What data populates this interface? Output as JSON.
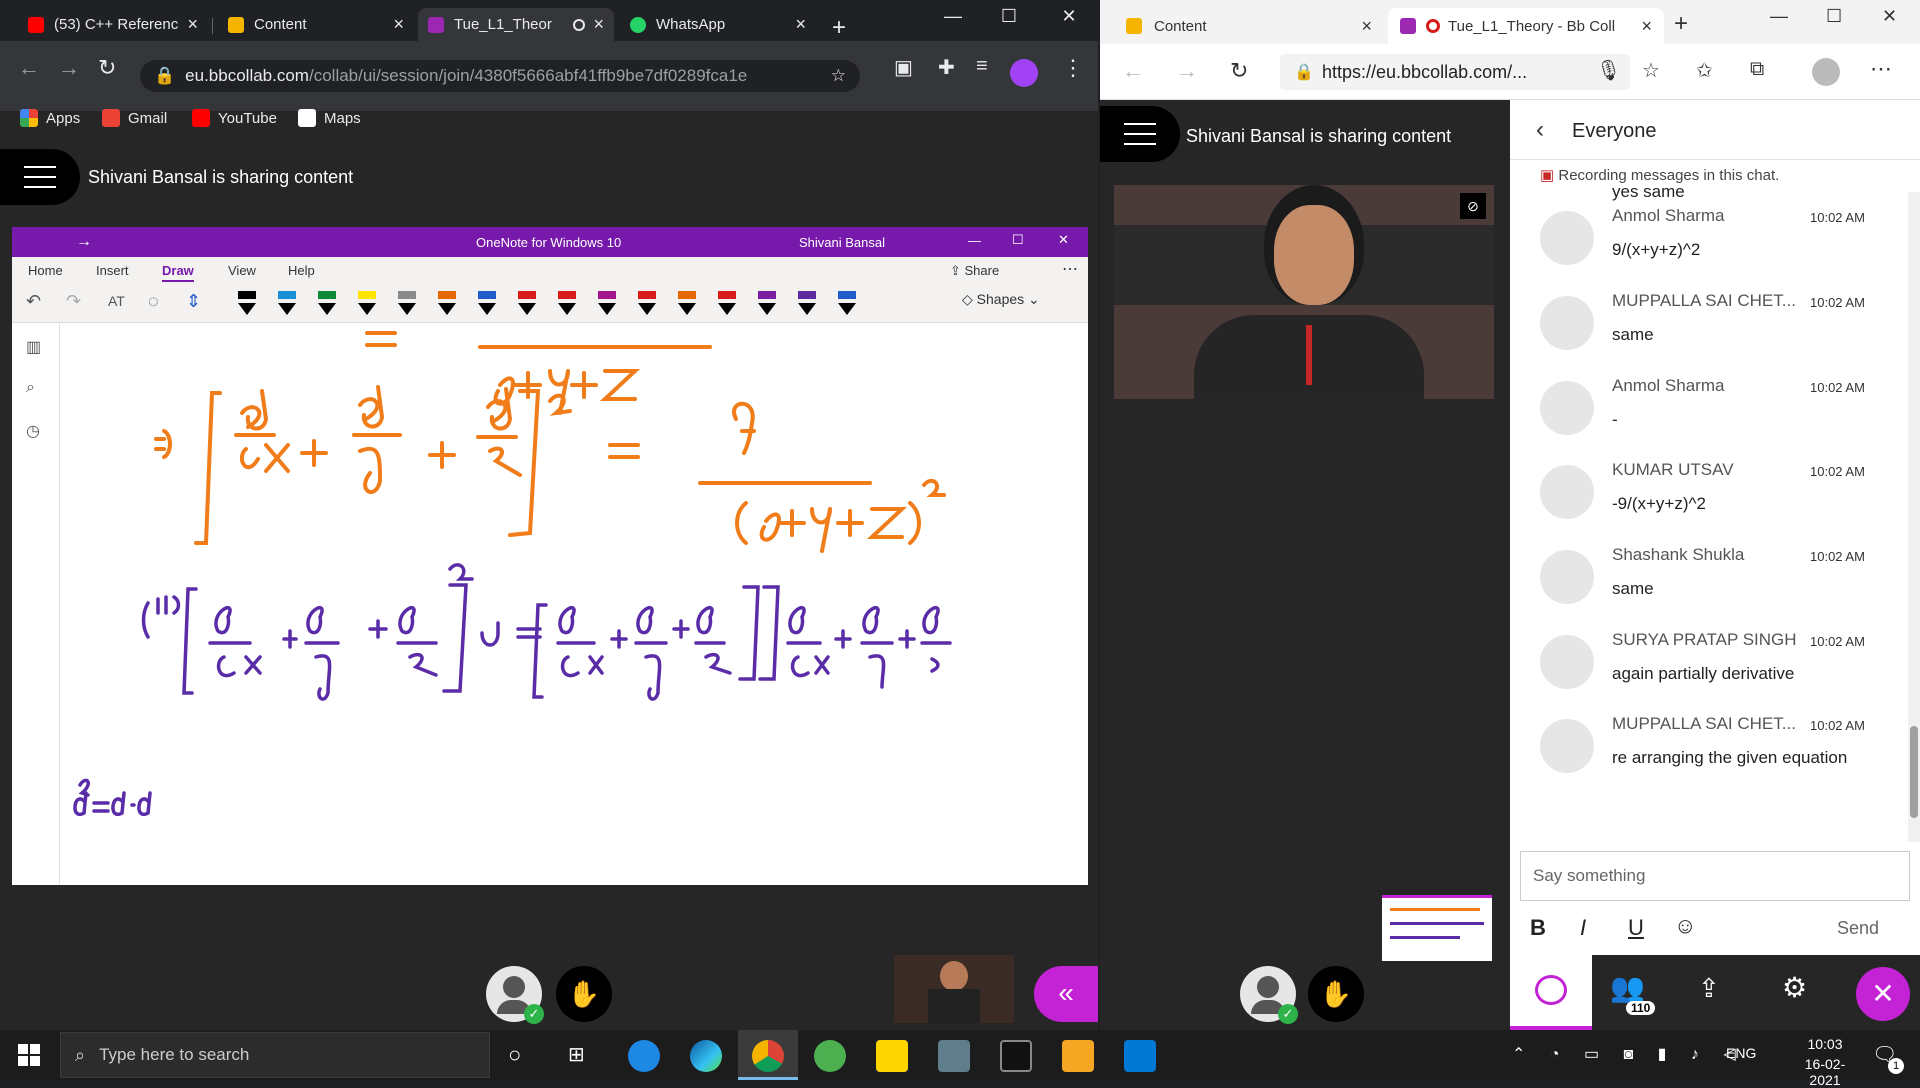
{
  "left_browser": {
    "tabs": [
      {
        "label": "(53) C++ Referenc",
        "color": "#ff0000"
      },
      {
        "label": "Content",
        "color": "#f4b400"
      },
      {
        "label": "Tue_L1_Theor",
        "color": "#9c27b0"
      },
      {
        "label": "WhatsApp",
        "color": "#25d366"
      }
    ],
    "new_tab": "+",
    "url_host": "eu.bbcollab.com",
    "url_path": "/collab/ui/session/join/4380f5666abf41ffb9be7df0289fca1e",
    "bookmarks": [
      "Apps",
      "Gmail",
      "YouTube",
      "Maps"
    ],
    "sharing_title": "Shivani Bansal is sharing content"
  },
  "onenote": {
    "app_title": "OneNote for Windows 10",
    "user": "Shivani Bansal",
    "ribbon_tabs": [
      "Home",
      "Insert",
      "Draw",
      "View",
      "Help"
    ],
    "active_tab": "Draw",
    "share_label": "Share",
    "shapes_label": "Shapes",
    "pen_colors": [
      "#000000",
      "#1a8fd6",
      "#0b8a3a",
      "#ffe600",
      "#8a8a8a",
      "#e46a00",
      "#1d5cc9",
      "#d81b1b",
      "#d81b1b",
      "#a3148f",
      "#d81b1b",
      "#e46a00",
      "#d81b1b",
      "#7a1fa2",
      "#5b2ca0",
      "#1d5cc9"
    ],
    "math": {
      "line0": "=",
      "line1_lhs": "⇒ [∂u/∂x + ∂u/∂y + ∂u/∂z]² = 9/(x+y+z)²",
      "line1_denominator_top": "x+y+z",
      "line2": "(ii) [∂/∂x + ∂/∂y + ∂/∂z]² u = [∂/∂x + ∂/∂y + ∂/∂z][∂/∂x + ∂/∂y + ∂/∂",
      "line3": "a² = a·a"
    }
  },
  "right_browser": {
    "tabs": [
      {
        "label": "Content"
      },
      {
        "label": "Tue_L1_Theory - Bb Coll"
      }
    ],
    "url": "https://eu.bbcollab.com/...",
    "sharing_title": "Shivani Bansal is sharing content"
  },
  "chat": {
    "title": "Everyone",
    "recording_notice": "Recording messages in this chat.",
    "partial_top": "yes same",
    "messages": [
      {
        "name": "Anmol Sharma",
        "time": "10:02 AM",
        "text": "9/(x+y+z)^2"
      },
      {
        "name": "MUPPALLA SAI CHET...",
        "time": "10:02 AM",
        "text": "same"
      },
      {
        "name": "Anmol Sharma",
        "time": "10:02 AM",
        "text": "-"
      },
      {
        "name": "KUMAR UTSAV",
        "time": "10:02 AM",
        "text": "-9/(x+y+z)^2"
      },
      {
        "name": "Shashank Shukla",
        "time": "10:02 AM",
        "text": "same"
      },
      {
        "name": "SURYA PRATAP SINGH",
        "time": "10:02 AM",
        "text": "again partially derivative"
      },
      {
        "name": "MUPPALLA SAI CHET...",
        "time": "10:02 AM",
        "text": "re arranging the given equation"
      }
    ],
    "input_placeholder": "Say something",
    "format_bold": "B",
    "format_italic": "I",
    "format_underline": "U",
    "send_label": "Send",
    "participants_count": "110"
  },
  "taskbar": {
    "search_placeholder": "Type here to search",
    "language": "ENG",
    "time": "10:03",
    "date": "16-02-2021",
    "notification_count": "1"
  },
  "colors": {
    "accent_purple": "#7719aa",
    "collab_purple": "#c322d5",
    "ink_orange": "#f07d1a",
    "ink_purple": "#5a2ca8"
  }
}
